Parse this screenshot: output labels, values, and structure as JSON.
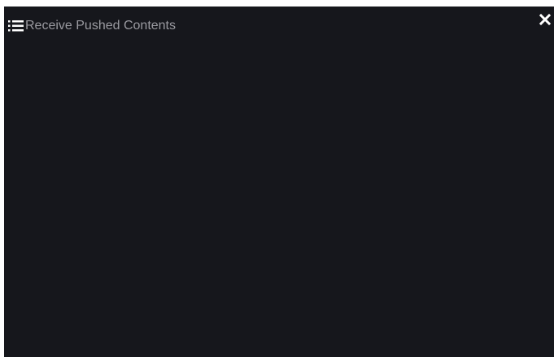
{
  "dialog": {
    "title": "Receive Pushed Contents",
    "menu_icon": "list-icon",
    "close_icon": "close-icon"
  },
  "colors": {
    "panel_background": "#16171c",
    "title_text": "#9a9aa0",
    "icon": "#ffffff"
  }
}
